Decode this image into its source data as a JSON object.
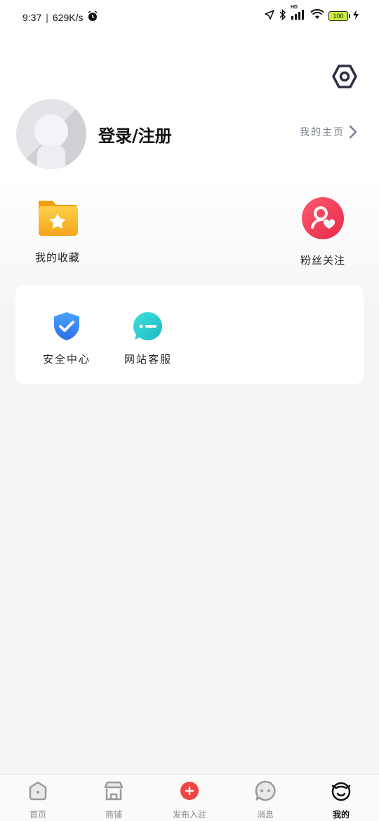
{
  "status": {
    "time": "9:37",
    "speed": "629K/s",
    "battery": "100",
    "network_badge": "HD"
  },
  "profile": {
    "login_label": "登录/注册",
    "home_link": "我的主页"
  },
  "quick": {
    "favorites": "我的收藏",
    "fans": "粉丝关注"
  },
  "services": [
    {
      "label": "安全中心",
      "icon": "shield-check-icon"
    },
    {
      "label": "网站客服",
      "icon": "chat-bubble-icon"
    }
  ],
  "tabbar": {
    "items": [
      {
        "label": "首页",
        "icon": "home-icon",
        "active": false
      },
      {
        "label": "商铺",
        "icon": "store-icon",
        "active": false
      },
      {
        "label": "发布入驻",
        "icon": "plus-circle-icon",
        "active": false
      },
      {
        "label": "消息",
        "icon": "message-icon",
        "active": false
      },
      {
        "label": "我的",
        "icon": "profile-face-icon",
        "active": true
      }
    ]
  },
  "colors": {
    "accent_red": "#ef4444",
    "folder_yellow": "#f7b52b",
    "fans_red": "#ee3f57",
    "shield_blue": "#3b8cf2",
    "chat_teal": "#2ed3d0"
  }
}
